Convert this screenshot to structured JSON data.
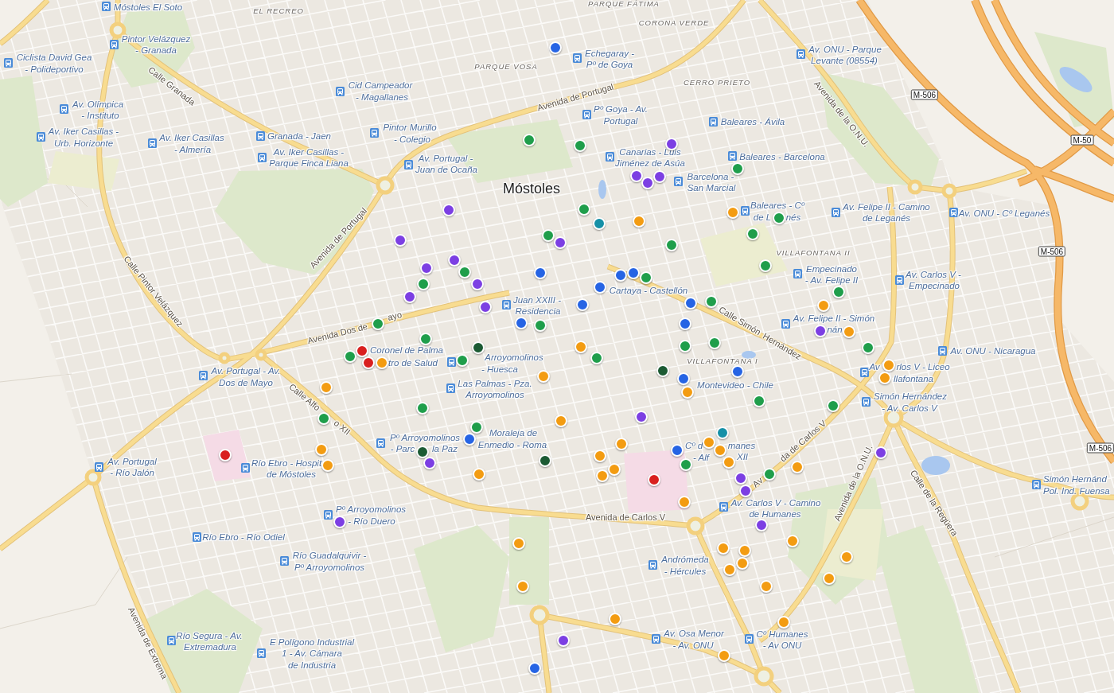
{
  "map": {
    "labels": [
      {
        "text": "PARQUE FÁTIMA",
        "kind": "area"
      },
      {
        "text": "EL RECREO",
        "kind": "area"
      },
      {
        "text": "CORONA VERDE",
        "kind": "area"
      },
      {
        "text": "PARQUE VOSA",
        "kind": "area"
      },
      {
        "text": "CERRO PRIETO",
        "kind": "area"
      },
      {
        "text": "Calle Granada",
        "kind": "street"
      },
      {
        "text": "Avenida de Portugal",
        "kind": "street"
      },
      {
        "text": "Avenida de la O.N.U.",
        "kind": "street"
      },
      {
        "text": "Móstoles",
        "kind": "city"
      },
      {
        "text": "Avenida de Portugal",
        "kind": "street"
      },
      {
        "text": "VILLAFONTANA II",
        "kind": "area"
      },
      {
        "text": "Calle Pintor Velázquez",
        "kind": "street"
      },
      {
        "text": "Avenida Dos de",
        "kind": "street"
      },
      {
        "text": "ayo",
        "kind": "street"
      },
      {
        "text": "Calle Simón",
        "kind": "street"
      },
      {
        "text": "Hernández",
        "kind": "street"
      },
      {
        "text": "VILLAFONTANA I",
        "kind": "area"
      },
      {
        "text": "Calle Alfo",
        "kind": "street"
      },
      {
        "text": "o XII",
        "kind": "street"
      },
      {
        "text": "Av",
        "kind": "street"
      },
      {
        "text": "da de Carlos V",
        "kind": "street"
      },
      {
        "text": "Avenida de la O.N.U.",
        "kind": "street"
      },
      {
        "text": "Calle de la Regüera",
        "kind": "street"
      },
      {
        "text": "Avenida de Carlos V",
        "kind": "street"
      },
      {
        "text": "Avenida de Extrema",
        "kind": "street"
      }
    ],
    "road_signs": [
      "M-506",
      "M-50",
      "M-506",
      "M-506"
    ],
    "bus_stops": [
      {
        "lines": [
          "Móstoles El Soto"
        ]
      },
      {
        "lines": [
          "Pintor Velázquez",
          "- Granada"
        ]
      },
      {
        "lines": [
          "Ciclista David Gea",
          "- Polideportivo"
        ]
      },
      {
        "lines": [
          "Echegaray -",
          "Pº de Goya"
        ]
      },
      {
        "lines": [
          "Av. ONU - Parque",
          "Levante (08554)"
        ]
      },
      {
        "lines": [
          "Cid Campeador",
          "- Magallanes"
        ]
      },
      {
        "lines": [
          "Av. Olímpica",
          "- Instituto"
        ]
      },
      {
        "lines": [
          "Pº Goya - Av.",
          "Portugal"
        ]
      },
      {
        "lines": [
          "Baleares - Ávila"
        ]
      },
      {
        "lines": [
          "Av. Iker Casillas -",
          "Urb. Horizonte"
        ]
      },
      {
        "lines": [
          "Av. Iker Casillas",
          "- Almería"
        ]
      },
      {
        "lines": [
          "Granada - Jaen"
        ]
      },
      {
        "lines": [
          "Pintor Murillo",
          "- Colegio"
        ]
      },
      {
        "lines": [
          "Av. Iker Casillas -",
          "Parque Finca Liana"
        ]
      },
      {
        "lines": [
          "Av. Portugal -",
          "Juan de Ocaña"
        ]
      },
      {
        "lines": [
          "Canarias - Luis",
          "Jiménez de Asúa"
        ]
      },
      {
        "lines": [
          "Baleares - Barcelona"
        ]
      },
      {
        "lines": [
          "Barcelona -",
          "San Marcial"
        ]
      },
      {
        "lines": [
          "Baleares - Cº",
          "de L",
          "nés"
        ]
      },
      {
        "lines": [
          "Av. Felipe II - Camino",
          "de Leganés"
        ]
      },
      {
        "lines": [
          "Av. ONU - Cº Leganés"
        ]
      },
      {
        "lines": [
          "Empecinado",
          "- Av. Felipe II"
        ]
      },
      {
        "lines": [
          "Cartaya - Castellón"
        ]
      },
      {
        "lines": [
          "Av. Carlos V -",
          "Empecinado"
        ]
      },
      {
        "lines": [
          "Juan XXIII -",
          "Residencia"
        ]
      },
      {
        "lines": [
          "Av. Felipe II - Simón",
          "nán"
        ]
      },
      {
        "lines": [
          "Coronel de Palma",
          "tro de Salud"
        ]
      },
      {
        "lines": [
          "Av. ONU - Nicaragua"
        ]
      },
      {
        "lines": [
          "Arroyomolinos",
          "- Huesca"
        ]
      },
      {
        "lines": [
          "Av. Portugal - Av.",
          "Dos de Mayo"
        ]
      },
      {
        "lines": [
          "Av",
          "rlos V - Liceo",
          "llafontana"
        ]
      },
      {
        "lines": [
          "Las Palmas - Pza.",
          "Arroyomolinos"
        ]
      },
      {
        "lines": [
          "Montevideo - Chile"
        ]
      },
      {
        "lines": [
          "Simón Hernández",
          "- Av. Carlos V"
        ]
      },
      {
        "lines": [
          "Pº Arroyomolinos",
          "- Parc",
          "la Paz"
        ]
      },
      {
        "lines": [
          "Moraleja de",
          "Enmedio - Roma"
        ]
      },
      {
        "lines": [
          "Cº d",
          "manes",
          "- Alf",
          "XII"
        ]
      },
      {
        "lines": [
          "Av. Portugal",
          "- Río Jalón"
        ]
      },
      {
        "lines": [
          "Río Ebro - Hospit",
          "de Móstoles"
        ]
      },
      {
        "lines": [
          "Simón Hernánd",
          "Pol. Ind. Fuensa"
        ]
      },
      {
        "lines": [
          "Pº Arroyomolinos",
          "- Río Duero"
        ]
      },
      {
        "lines": [
          "Av. Carlos V - Camino",
          "de Humanes"
        ]
      },
      {
        "lines": [
          "Río Ebro - Río Odiel"
        ]
      },
      {
        "lines": [
          "Río Guadalquivir -",
          "Pº Arroyomolinos"
        ]
      },
      {
        "lines": [
          "Andrómeda",
          "- Hércules"
        ]
      },
      {
        "lines": [
          "Río Segura - Av.",
          "Extremadura"
        ]
      },
      {
        "lines": [
          "E Polígono Industrial",
          "1 - Av. Cámara",
          "de Industria"
        ]
      },
      {
        "lines": [
          "Av. Osa Menor",
          "- Av. ONU"
        ]
      },
      {
        "lines": [
          "Cº Humanes",
          "- Av ONU"
        ]
      }
    ],
    "markers": [
      {
        "color": "#2664e4"
      },
      {
        "color": "#1f9e4b"
      },
      {
        "color": "#1f9e4b"
      },
      {
        "color": "#7c3fe3"
      },
      {
        "color": "#1f9e4b"
      },
      {
        "color": "#7c3fe3"
      },
      {
        "color": "#7c3fe3"
      },
      {
        "color": "#7c3fe3"
      },
      {
        "color": "#7c3fe3"
      },
      {
        "color": "#1f9e4b"
      },
      {
        "color": "#1590a7"
      },
      {
        "color": "#f39c12"
      },
      {
        "color": "#f39c12"
      },
      {
        "color": "#1f9e4b"
      },
      {
        "color": "#1f9e4b"
      },
      {
        "color": "#7c3fe3"
      },
      {
        "color": "#1f9e4b"
      },
      {
        "color": "#7c3fe3"
      },
      {
        "color": "#1f9e4b"
      },
      {
        "color": "#7c3fe3"
      },
      {
        "color": "#7c3fe3"
      },
      {
        "color": "#1f9e4b"
      },
      {
        "color": "#2664e4"
      },
      {
        "color": "#1f9e4b"
      },
      {
        "color": "#1f9e4b"
      },
      {
        "color": "#7c3fe3"
      },
      {
        "color": "#2664e4"
      },
      {
        "color": "#2664e4"
      },
      {
        "color": "#1f9e4b"
      },
      {
        "color": "#2664e4"
      },
      {
        "color": "#1f9e4b"
      },
      {
        "color": "#7c3fe3"
      },
      {
        "color": "#7c3fe3"
      },
      {
        "color": "#2664e4"
      },
      {
        "color": "#2664e4"
      },
      {
        "color": "#1f9e4b"
      },
      {
        "color": "#f39c12"
      },
      {
        "color": "#2664e4"
      },
      {
        "color": "#1f9e4b"
      },
      {
        "color": "#1f9e4b"
      },
      {
        "color": "#2664e4"
      },
      {
        "color": "#7c3fe3"
      },
      {
        "color": "#f39c12"
      },
      {
        "color": "#1f9e4b"
      },
      {
        "color": "#f39c12"
      },
      {
        "color": "#1f9e4b"
      },
      {
        "color": "#1f9e4b"
      },
      {
        "color": "#1f9e4b"
      },
      {
        "color": "#1f9e4b"
      },
      {
        "color": "#d9201f"
      },
      {
        "color": "#d9201f"
      },
      {
        "color": "#f39c12"
      },
      {
        "color": "#1b5a33"
      },
      {
        "color": "#1f9e4b"
      },
      {
        "color": "#1f9e4b"
      },
      {
        "color": "#1b5a33"
      },
      {
        "color": "#2664e4"
      },
      {
        "color": "#f39c12"
      },
      {
        "color": "#f39c12"
      },
      {
        "color": "#f39c12"
      },
      {
        "color": "#2664e4"
      },
      {
        "color": "#f39c12"
      },
      {
        "color": "#f39c12"
      },
      {
        "color": "#1f9e4b"
      },
      {
        "color": "#1f9e4b"
      },
      {
        "color": "#1f9e4b"
      },
      {
        "color": "#1f9e4b"
      },
      {
        "color": "#f39c12"
      },
      {
        "color": "#7c3fe3"
      },
      {
        "color": "#1f9e4b"
      },
      {
        "color": "#2664e4"
      },
      {
        "color": "#1590a7"
      },
      {
        "color": "#f39c12"
      },
      {
        "color": "#f39c12"
      },
      {
        "color": "#2664e4"
      },
      {
        "color": "#f39c12"
      },
      {
        "color": "#f39c12"
      },
      {
        "color": "#1f9e4b"
      },
      {
        "color": "#f39c12"
      },
      {
        "color": "#1b5a33"
      },
      {
        "color": "#7c3fe3"
      },
      {
        "color": "#1b5a33"
      },
      {
        "color": "#f39c12"
      },
      {
        "color": "#f39c12"
      },
      {
        "color": "#f39c12"
      },
      {
        "color": "#d9201f"
      },
      {
        "color": "#f39c12"
      },
      {
        "color": "#7c3fe3"
      },
      {
        "color": "#f39c12"
      },
      {
        "color": "#1f9e4b"
      },
      {
        "color": "#f39c12"
      },
      {
        "color": "#d9201f"
      },
      {
        "color": "#7c3fe3"
      },
      {
        "color": "#7c3fe3"
      },
      {
        "color": "#f39c12"
      },
      {
        "color": "#7c3fe3"
      },
      {
        "color": "#7c3fe3"
      },
      {
        "color": "#f39c12"
      },
      {
        "color": "#f39c12"
      },
      {
        "color": "#f39c12"
      },
      {
        "color": "#f39c12"
      },
      {
        "color": "#f39c12"
      },
      {
        "color": "#f39c12"
      },
      {
        "color": "#f39c12"
      },
      {
        "color": "#f39c12"
      },
      {
        "color": "#f39c12"
      },
      {
        "color": "#f39c12"
      },
      {
        "color": "#f39c12"
      },
      {
        "color": "#f39c12"
      },
      {
        "color": "#7c3fe3"
      },
      {
        "color": "#f39c12"
      },
      {
        "color": "#2664e4"
      }
    ]
  }
}
